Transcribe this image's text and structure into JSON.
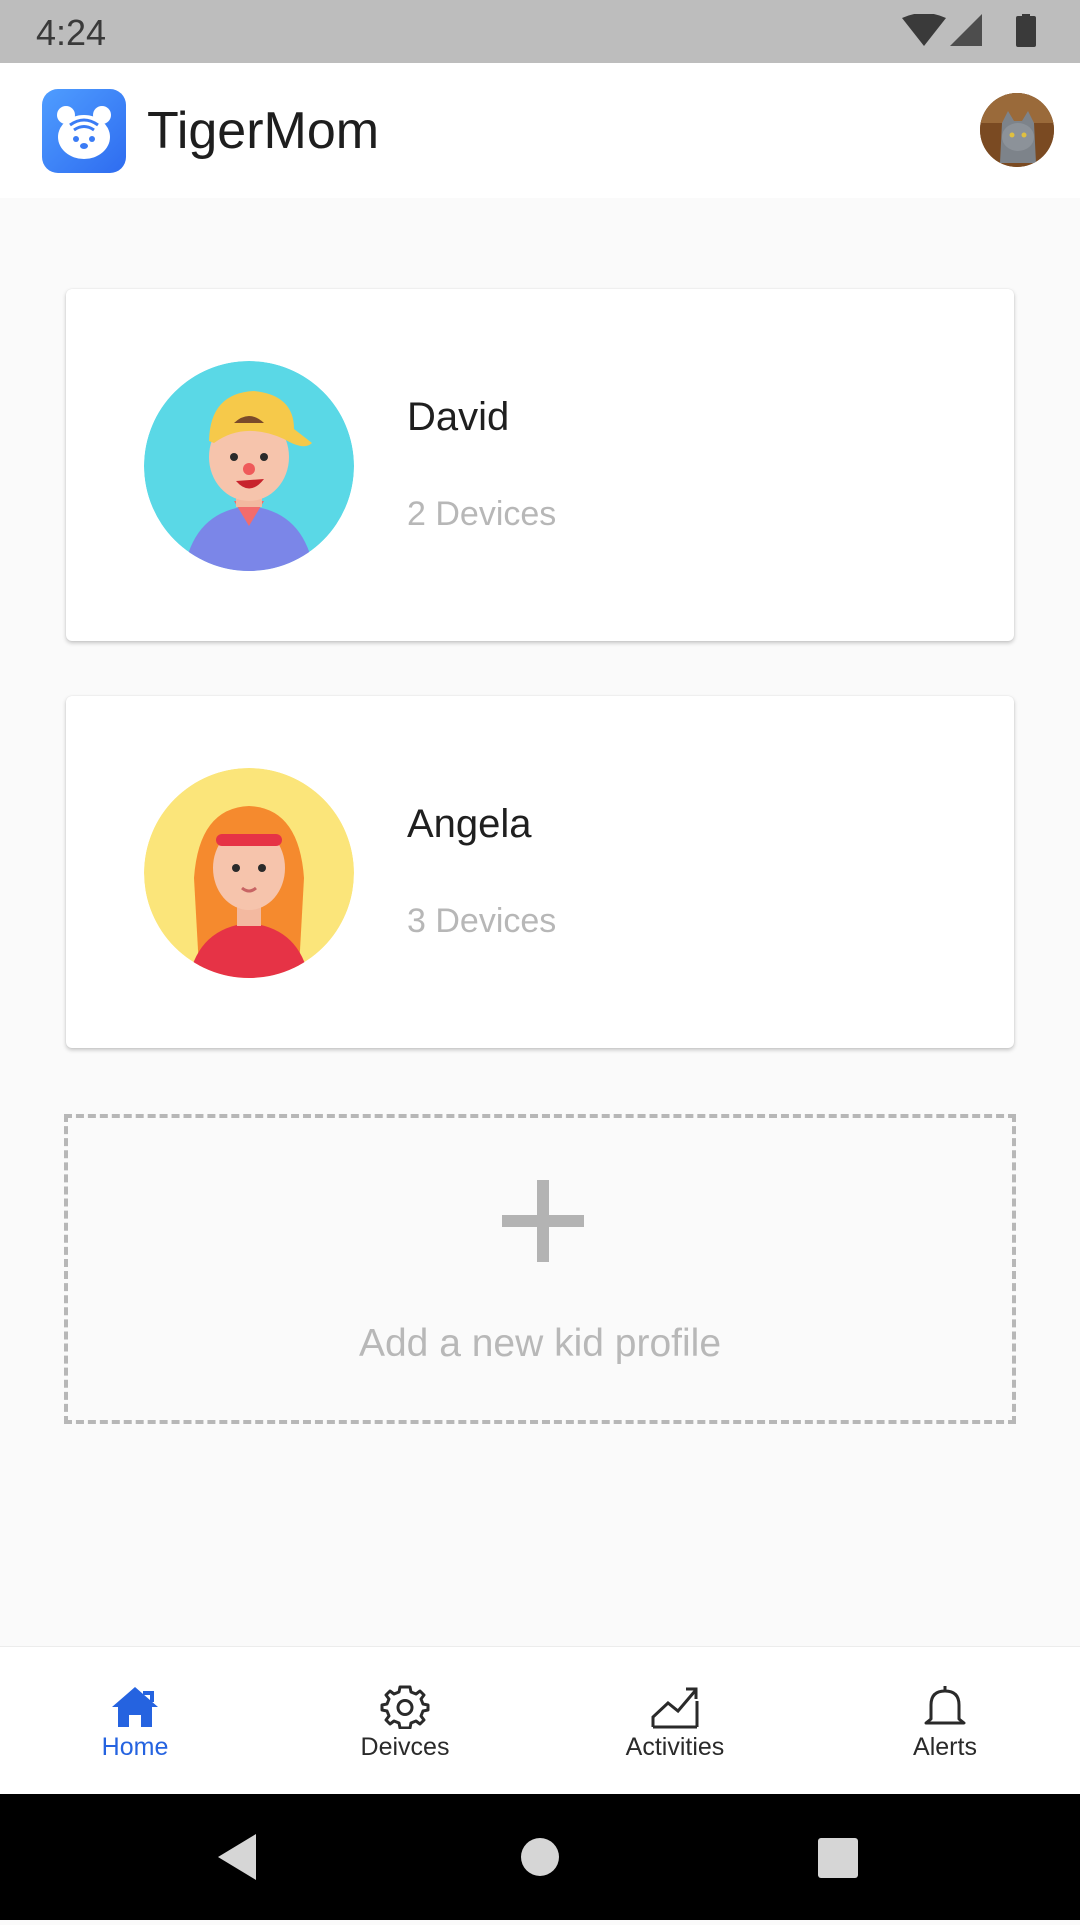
{
  "status_bar": {
    "time": "4:24"
  },
  "app_bar": {
    "title": "TigerMom"
  },
  "kids": [
    {
      "name": "David",
      "devices": "2 Devices",
      "avatar_color": "#5ad8e6"
    },
    {
      "name": "Angela",
      "devices": "3 Devices",
      "avatar_color": "#fbe57a"
    }
  ],
  "add_profile": {
    "label": "Add a new kid profile"
  },
  "bottom_nav": {
    "items": [
      {
        "label": "Home",
        "icon": "home-icon",
        "active": true
      },
      {
        "label": "Deivces",
        "icon": "gear-icon",
        "active": false
      },
      {
        "label": "Activities",
        "icon": "chart-icon",
        "active": false
      },
      {
        "label": "Alerts",
        "icon": "bell-icon",
        "active": false
      }
    ]
  },
  "colors": {
    "accent": "#2563e0",
    "background": "#fafafa",
    "muted_text": "#b7b7b7"
  }
}
